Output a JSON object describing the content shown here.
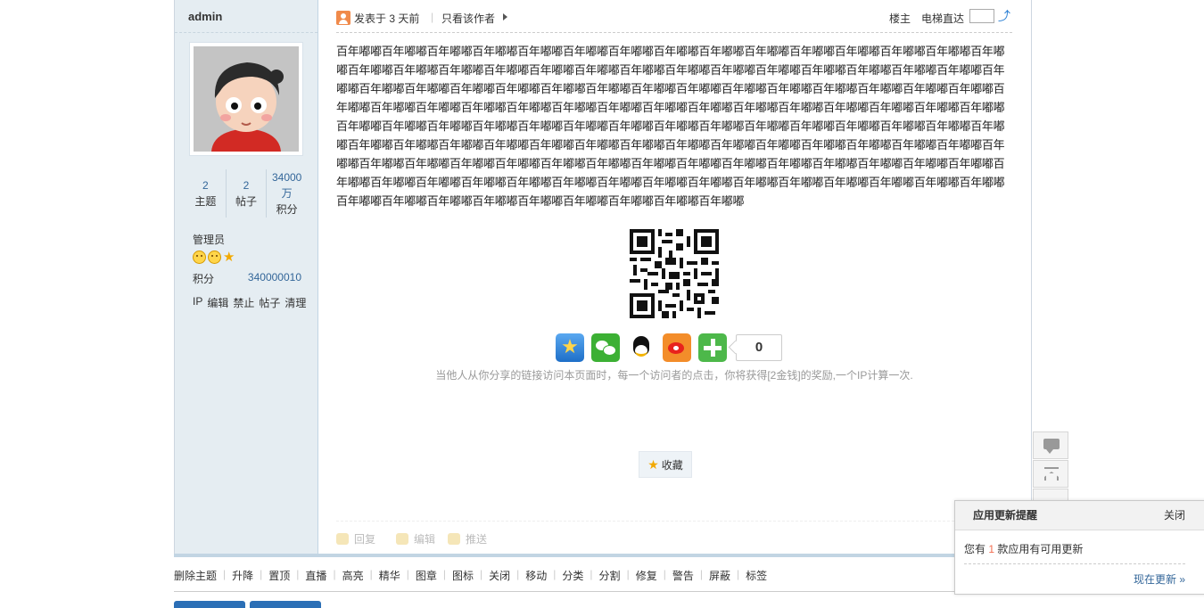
{
  "author": {
    "name": "admin",
    "stats": [
      {
        "value": "2",
        "label": "主题"
      },
      {
        "value": "2",
        "label": "帖子"
      },
      {
        "value": "34000万",
        "label": "积分"
      }
    ],
    "group": "管理员",
    "credit_label": "积分",
    "credit_value": "340000010",
    "admin_links": [
      "IP",
      "编辑",
      "禁止",
      "帖子",
      "清理"
    ]
  },
  "post_header": {
    "posted": "发表于 3 天前",
    "separator": "|",
    "only_author": "只看该作者",
    "floor": "楼主",
    "elevator": "电梯直达"
  },
  "post": {
    "body": "百年嘟嘟百年嘟嘟百年嘟嘟百年嘟嘟百年嘟嘟百年嘟嘟百年嘟嘟百年嘟嘟百年嘟嘟百年嘟嘟百年嘟嘟百年嘟嘟百年嘟嘟百年嘟嘟百年嘟嘟百年嘟嘟百年嘟嘟百年嘟嘟百年嘟嘟百年嘟嘟百年嘟嘟百年嘟嘟百年嘟嘟百年嘟嘟百年嘟嘟百年嘟嘟百年嘟嘟百年嘟嘟百年嘟嘟百年嘟嘟百年嘟嘟百年嘟嘟百年嘟嘟百年嘟嘟百年嘟嘟百年嘟嘟百年嘟嘟百年嘟嘟百年嘟嘟百年嘟嘟百年嘟嘟百年嘟嘟百年嘟嘟百年嘟嘟百年嘟嘟百年嘟嘟百年嘟嘟百年嘟嘟百年嘟嘟百年嘟嘟百年嘟嘟百年嘟嘟百年嘟嘟百年嘟嘟百年嘟嘟百年嘟嘟百年嘟嘟百年嘟嘟百年嘟嘟百年嘟嘟百年嘟嘟百年嘟嘟百年嘟嘟百年嘟嘟百年嘟嘟百年嘟嘟百年嘟嘟百年嘟嘟百年嘟嘟百年嘟嘟百年嘟嘟百年嘟嘟百年嘟嘟百年嘟嘟百年嘟嘟百年嘟嘟百年嘟嘟百年嘟嘟百年嘟嘟百年嘟嘟百年嘟嘟百年嘟嘟百年嘟嘟百年嘟嘟百年嘟嘟百年嘟嘟百年嘟嘟百年嘟嘟百年嘟嘟百年嘟嘟百年嘟嘟百年嘟嘟百年嘟嘟百年嘟嘟百年嘟嘟百年嘟嘟百年嘟嘟百年嘟嘟百年嘟嘟百年嘟嘟百年嘟嘟百年嘟嘟百年嘟嘟百年嘟嘟百年嘟嘟百年嘟嘟百年嘟嘟百年嘟嘟百年嘟嘟百年嘟嘟百年嘟嘟百年嘟嘟百年嘟嘟百年嘟嘟百年嘟嘟百年嘟嘟百年嘟嘟百年嘟嘟百年嘟嘟百年嘟嘟百年嘟嘟百年嘟嘟百年嘟嘟百年嘟嘟百年嘟嘟百年嘟嘟百年嘟嘟"
  },
  "share": {
    "count": "0",
    "note": "当他人从你分享的链接访问本页面时，每一个访问者的点击，你将获得[2金钱]的奖励,一个IP计算一次."
  },
  "favorite_label": "收藏",
  "post_actions": [
    "回复",
    "编辑",
    "推送"
  ],
  "mod_actions": [
    "删除主题",
    "升降",
    "置顶",
    "直播",
    "高亮",
    "精华",
    "图章",
    "图标",
    "关闭",
    "移动",
    "分类",
    "分割",
    "修复",
    "警告",
    "屏蔽",
    "标签"
  ],
  "notice": {
    "title": "应用更新提醒",
    "close": "关闭",
    "body_pre": "您有",
    "count": "1",
    "body_post": "款应用有可用更新",
    "link": "现在更新 »"
  },
  "colors": {
    "sidebar_bg": "#e5edf2",
    "link_blue": "#336699",
    "highlight_orange": "#f26c4f"
  }
}
